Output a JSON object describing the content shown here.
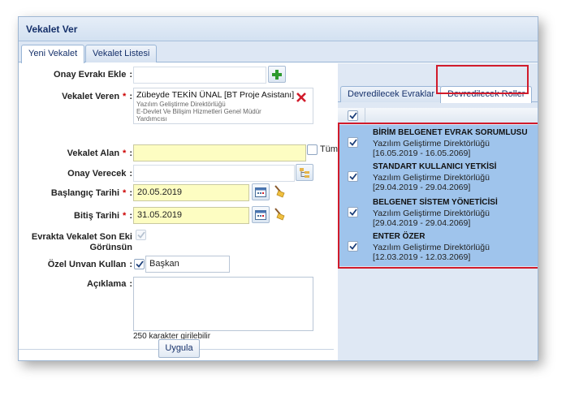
{
  "window": {
    "title": "Vekalet Ver"
  },
  "tabs": [
    {
      "label": "Yeni Vekalet",
      "active": true
    },
    {
      "label": "Vekalet Listesi",
      "active": false
    }
  ],
  "form": {
    "onay_evraki_label": "Onay Evrakı Ekle",
    "vekalet_veren_label": "Vekalet Veren",
    "vekalet_veren": {
      "name": "Zübeyde TEKİN ÜNAL [BT Proje Asistanı]",
      "unit": "Yazılım Geliştirme Direktörlüğü",
      "dept_line1": "E-Devlet Ve Bilişim Hizmetleri Genel Müdür",
      "dept_line2": "Yardımcısı"
    },
    "vekalet_alan_label": "Vekalet Alan",
    "vekalet_alan_value": "",
    "tumu_label": "Tümü",
    "onay_verecek_label": "Onay Verecek",
    "onay_verecek_value": "",
    "baslangic_label": "Başlangıç Tarihi",
    "baslangic_value": "20.05.2019",
    "bitis_label": "Bitiş Tarihi",
    "bitis_value": "31.05.2019",
    "son_eki_label_line1": "Evrakta Vekalet Son Eki",
    "son_eki_label_line2": "Görünsün",
    "ozel_unvan_label": "Özel Unvan Kullan",
    "ozel_unvan_value": "Başkan",
    "aciklama_label": "Açıklama",
    "aciklama_value": "",
    "char_limit": "250 karakter girilebilir",
    "submit_label": "Uygula"
  },
  "right": {
    "tabs": [
      {
        "label": "Devredilecek Evraklar",
        "active": false
      },
      {
        "label": "Devredilecek Roller",
        "active": true
      }
    ],
    "roles": [
      {
        "title": "BİRİM BELGENET EVRAK SORUMLUSU",
        "unit": "Yazılım Geliştirme Direktörlüğü",
        "dates": "[16.05.2019 - 16.05.2069]",
        "checked": true
      },
      {
        "title": "STANDART KULLANICI YETKİSİ",
        "unit": "Yazılım Geliştirme Direktörlüğü",
        "dates": "[29.04.2019 - 29.04.2069]",
        "checked": true
      },
      {
        "title": "BELGENET SİSTEM YÖNETİCİSİ",
        "unit": "Yazılım Geliştirme Direktörlüğü",
        "dates": "[29.04.2019 - 29.04.2069]",
        "checked": true
      },
      {
        "title": "ENTER ÖZER",
        "unit": "Yazılım Geliştirme Direktörlüğü",
        "dates": "[12.03.2019 - 12.03.2069]",
        "checked": true
      }
    ]
  },
  "colors": {
    "title": "#15306a",
    "required": "#cc0000",
    "highlight_border": "#d11b2b",
    "selected_rows": "#9fc4ec",
    "date_field": "#fdfdc2"
  }
}
